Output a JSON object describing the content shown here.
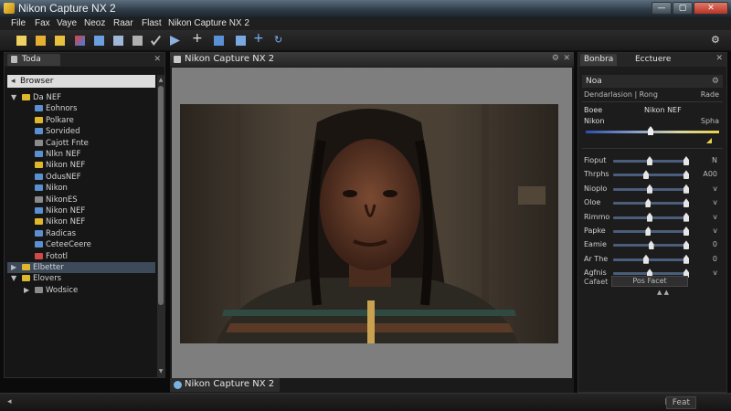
{
  "window": {
    "title": "Nikon Capture NX 2"
  },
  "menu": [
    "File",
    "Fax",
    "Vaye",
    "Neoz",
    "Raar",
    "Flast",
    "Nikon Capture NX 2"
  ],
  "toolbar": {
    "icons": [
      "new-icon",
      "open-folder-icon",
      "folder-icon",
      "paint-icon",
      "copy-icon",
      "layers-icon",
      "crop-icon",
      "check-icon",
      "play-icon",
      "plus-icon",
      "export-icon",
      "grid-icon",
      "move-icon",
      "rotate-icon",
      "run-icon"
    ]
  },
  "left_panel": {
    "tab_label": "Toda",
    "browser_label": "Browser",
    "tree": [
      {
        "label": "Da NEF",
        "indent": 0,
        "expand": "▼",
        "color": "#e0b62a"
      },
      {
        "label": "Eohnors",
        "indent": 1,
        "expand": "",
        "color": "#5a8fd0"
      },
      {
        "label": "Polkare",
        "indent": 1,
        "expand": "",
        "color": "#e0b62a"
      },
      {
        "label": "Sorvided",
        "indent": 1,
        "expand": "",
        "color": "#5a8fd0"
      },
      {
        "label": "Cajott Fnte",
        "indent": 1,
        "expand": "",
        "color": "#8a8a8a"
      },
      {
        "label": "Nlkn NEF",
        "indent": 1,
        "expand": "",
        "color": "#5a8fd0"
      },
      {
        "label": "Nikon NEF",
        "indent": 1,
        "expand": "",
        "color": "#e0b62a"
      },
      {
        "label": "OdusNEF",
        "indent": 1,
        "expand": "",
        "color": "#5a8fd0"
      },
      {
        "label": "Nikon",
        "indent": 1,
        "expand": "",
        "color": "#5a8fd0"
      },
      {
        "label": "NikonES",
        "indent": 1,
        "expand": "",
        "color": "#8a8a8a"
      },
      {
        "label": "Nikon NEF",
        "indent": 1,
        "expand": "",
        "color": "#5a8fd0"
      },
      {
        "label": "Nikon NEF",
        "indent": 1,
        "expand": "",
        "color": "#e0b62a"
      },
      {
        "label": "Radicas",
        "indent": 1,
        "expand": "",
        "color": "#5a8fd0"
      },
      {
        "label": "CeteeCeere",
        "indent": 1,
        "expand": "",
        "color": "#5a8fd0"
      },
      {
        "label": "Fototl",
        "indent": 1,
        "expand": "",
        "color": "#d04848"
      },
      {
        "label": "Elbetter",
        "indent": 0,
        "expand": "▶",
        "color": "#e0b62a",
        "selected": true
      },
      {
        "label": "Elovers",
        "indent": 0,
        "expand": "▼",
        "color": "#e0b62a"
      },
      {
        "label": "Wodsice",
        "indent": 1,
        "expand": "▶",
        "color": "#8a8a8a"
      }
    ]
  },
  "center": {
    "doc_tab": "Nikon Capture NX 2",
    "bottom_tab": "Nikon Capture NX 2"
  },
  "right_panel": {
    "tab1": "Bonbra",
    "tab2": "Ecctuere",
    "section_label": "Noa",
    "sub_left": "Dendarlasion | Rong",
    "sub_right": "Rade",
    "row1_left": "Boee",
    "row1_right": "Nikon NEF",
    "row2_left": "Nikon",
    "row2_right": "Spha",
    "sliders": [
      {
        "label": "Fioput",
        "value": "N",
        "pos": 0.5
      },
      {
        "label": "Thrphs",
        "value": "A00",
        "pos": 0.45
      },
      {
        "label": "Nioplo",
        "value": "v",
        "pos": 0.5
      },
      {
        "label": "Oloe",
        "value": "v",
        "pos": 0.48
      },
      {
        "label": "Rimmo",
        "value": "v",
        "pos": 0.5
      },
      {
        "label": "Papke",
        "value": "v",
        "pos": 0.48
      },
      {
        "label": "Eamie",
        "value": "0",
        "pos": 0.52
      },
      {
        "label": "Ar The",
        "value": "0",
        "pos": 0.45
      },
      {
        "label": "Agfnis",
        "value": "v",
        "pos": 0.5
      }
    ],
    "footer_label": "Cafaet",
    "footer_button": "Pos Facet"
  },
  "status": {
    "left": "◂",
    "right_label": "Feat",
    "right_icon": "◧"
  }
}
